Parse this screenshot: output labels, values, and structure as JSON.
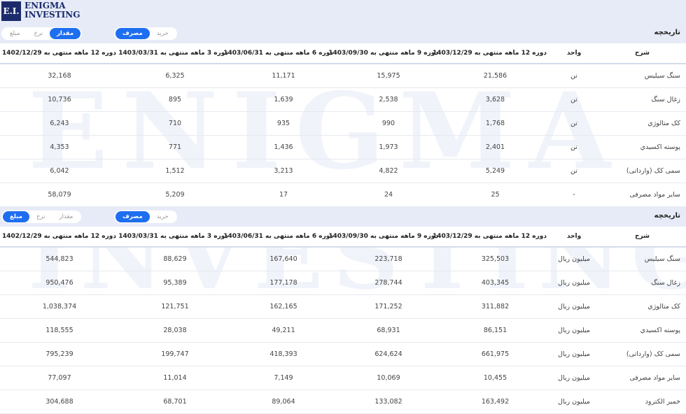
{
  "brand": {
    "mark": "E.I.",
    "line1": "ENIGMA",
    "line2": "INVESTING"
  },
  "watermark": {
    "line1": "ENIGMA",
    "line2": "INVESTING"
  },
  "panels": [
    {
      "title": "تاریخچه",
      "toggle_type": [
        {
          "label": "خرید",
          "active": false
        },
        {
          "label": "مصرف",
          "active": true
        }
      ],
      "toggle_metric": [
        {
          "label": "مقدار",
          "active": true
        },
        {
          "label": "نرخ",
          "active": false
        },
        {
          "label": "مبلغ",
          "active": false
        }
      ],
      "headers": [
        "شرح",
        "واحد",
        "دوره 12 ماهه منتهی به 1403/12/29",
        "دوره 9 ماهه منتهی به 1403/09/30",
        "دوره 6 ماهه منتهی به 1403/06/31",
        "دوره 3 ماهه منتهی به 1403/03/31",
        "دوره 12 ماهه منتهی به 1402/12/29"
      ],
      "rows": [
        [
          "سنگ سیلیس",
          "تن",
          "21,586",
          "15,975",
          "11,171",
          "6,325",
          "32,168"
        ],
        [
          "زغال سنگ",
          "تن",
          "3,628",
          "2,538",
          "1,639",
          "895",
          "10,736"
        ],
        [
          "کک متالوژي",
          "تن",
          "1,768",
          "990",
          "935",
          "710",
          "6,243"
        ],
        [
          "پوسته اکسیدي",
          "تن",
          "2,401",
          "1,973",
          "1,436",
          "771",
          "4,353"
        ],
        [
          "سمی کک (وارداتی)",
          "تن",
          "5,249",
          "4,822",
          "3,213",
          "1,512",
          "6,042"
        ],
        [
          "سایر مواد مصرفی",
          "-",
          "25",
          "24",
          "17",
          "5,209",
          "58,079"
        ]
      ]
    },
    {
      "title": "تاریخچه",
      "toggle_type": [
        {
          "label": "خرید",
          "active": false
        },
        {
          "label": "مصرف",
          "active": true
        }
      ],
      "toggle_metric": [
        {
          "label": "مقدار",
          "active": false
        },
        {
          "label": "نرخ",
          "active": false
        },
        {
          "label": "مبلغ",
          "active": true
        }
      ],
      "headers": [
        "شرح",
        "واحد",
        "دوره 12 ماهه منتهی به 1403/12/29",
        "دوره 9 ماهه منتهی به 1403/09/30",
        "دوره 6 ماهه منتهی به 1403/06/31",
        "دوره 3 ماهه منتهی به 1403/03/31",
        "دوره 12 ماهه منتهی به 1402/12/29"
      ],
      "rows": [
        [
          "سنگ سیلیس",
          "میلیون ریال",
          "325,503",
          "223,718",
          "167,640",
          "88,629",
          "544,823"
        ],
        [
          "زغال سنگ",
          "میلیون ریال",
          "403,345",
          "278,744",
          "177,178",
          "95,389",
          "950,476"
        ],
        [
          "کک متالوژي",
          "میلیون ریال",
          "311,882",
          "171,252",
          "162,165",
          "121,751",
          "1,038,374"
        ],
        [
          "پوسته اکسیدي",
          "میلیون ریال",
          "86,151",
          "68,931",
          "49,211",
          "28,038",
          "118,555"
        ],
        [
          "سمی کک (وارداتی)",
          "میلیون ریال",
          "661,975",
          "624,624",
          "418,393",
          "199,747",
          "795,239"
        ],
        [
          "سایر مواد مصرفی",
          "میلیون ریال",
          "10,455",
          "10,069",
          "7,149",
          "11,014",
          "77,097"
        ],
        [
          "خمیر الکترود",
          "میلیون ریال",
          "163,492",
          "133,082",
          "89,064",
          "68,701",
          "304,688"
        ]
      ]
    }
  ],
  "colors": {
    "accent": "#1e6ef0",
    "header_bg": "#e6ebf7",
    "logo": "#1b2a6b"
  }
}
